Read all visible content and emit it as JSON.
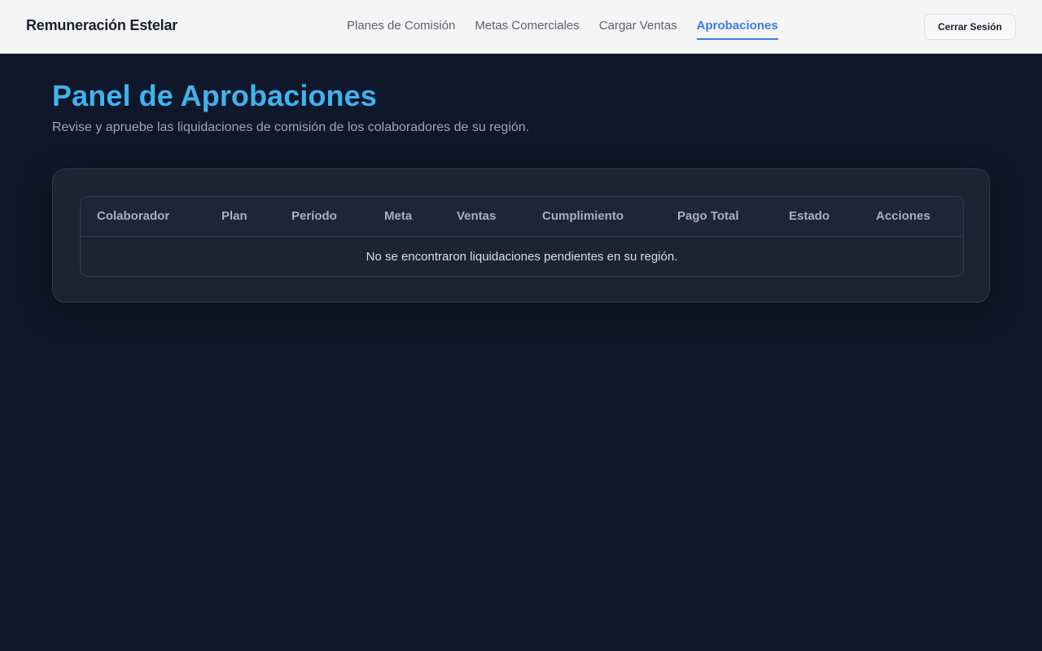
{
  "app": {
    "brand": "Remuneración Estelar"
  },
  "nav": {
    "items": [
      {
        "label": "Planes de Comisión",
        "active": false
      },
      {
        "label": "Metas Comerciales",
        "active": false
      },
      {
        "label": "Cargar Ventas",
        "active": false
      },
      {
        "label": "Aprobaciones",
        "active": true
      }
    ],
    "logout_label": "Cerrar Sesión"
  },
  "page": {
    "title": "Panel de Aprobaciones",
    "subtitle": "Revise y apruebe las liquidaciones de comisión de los colaboradores de su región."
  },
  "table": {
    "columns": [
      "Colaborador",
      "Plan",
      "Período",
      "Meta",
      "Ventas",
      "Cumplimiento",
      "Pago Total",
      "Estado",
      "Acciones"
    ],
    "empty_message": "No se encontraron liquidaciones pendientes en su región."
  },
  "colors": {
    "accent": "#3b7ddd",
    "title": "#3fb3f0",
    "background": "#0f172a",
    "card": "#1b2335"
  }
}
